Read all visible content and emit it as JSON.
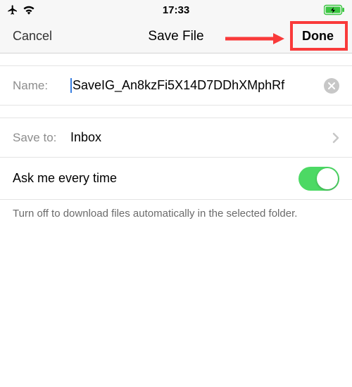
{
  "statusbar": {
    "time": "17:33"
  },
  "nav": {
    "cancel": "Cancel",
    "title": "Save File",
    "done": "Done"
  },
  "name_row": {
    "label": "Name:",
    "value": "SaveIG_An8kzFi5X14D7DDhXMphRf"
  },
  "saveto_row": {
    "label": "Save to:",
    "value": "Inbox"
  },
  "toggle_row": {
    "label": "Ask me every time",
    "on": true
  },
  "hint_text": "Turn off to download files automatically in the selected folder.",
  "colors": {
    "highlight": "#f93a3a",
    "switch_on": "#4cd964"
  }
}
